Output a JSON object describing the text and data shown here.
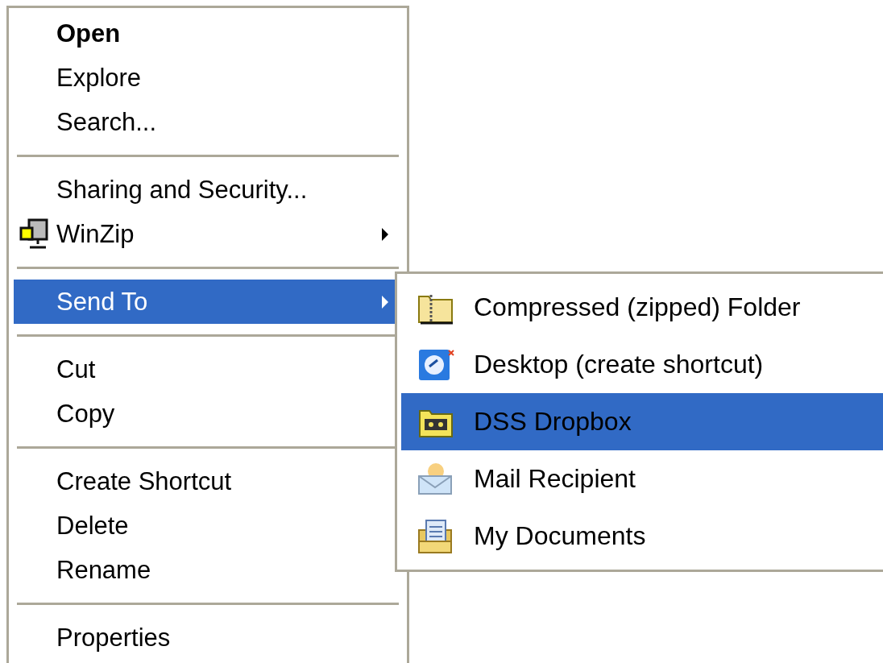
{
  "context_menu": {
    "items": [
      {
        "kind": "command",
        "label": "Open",
        "default": true,
        "selected": false,
        "has_submenu": false,
        "has_icon": false
      },
      {
        "kind": "command",
        "label": "Explore",
        "default": false,
        "selected": false,
        "has_submenu": false,
        "has_icon": false
      },
      {
        "kind": "command",
        "label": "Search...",
        "default": false,
        "selected": false,
        "has_submenu": false,
        "has_icon": false
      },
      {
        "kind": "separator"
      },
      {
        "kind": "command",
        "label": "Sharing and Security...",
        "default": false,
        "selected": false,
        "has_submenu": false,
        "has_icon": false
      },
      {
        "kind": "command",
        "label": "WinZip",
        "default": false,
        "selected": false,
        "has_submenu": true,
        "has_icon": true
      },
      {
        "kind": "separator"
      },
      {
        "kind": "command",
        "label": "Send To",
        "default": false,
        "selected": true,
        "has_submenu": true,
        "has_icon": false,
        "submenu": [
          {
            "label": "Compressed (zipped) Folder",
            "selected": false
          },
          {
            "label": "Desktop (create shortcut)",
            "selected": false
          },
          {
            "label": "DSS Dropbox",
            "selected": true
          },
          {
            "label": "Mail Recipient",
            "selected": false
          },
          {
            "label": "My Documents",
            "selected": false
          }
        ]
      },
      {
        "kind": "separator"
      },
      {
        "kind": "command",
        "label": "Cut",
        "default": false,
        "selected": false,
        "has_submenu": false,
        "has_icon": false
      },
      {
        "kind": "command",
        "label": "Copy",
        "default": false,
        "selected": false,
        "has_submenu": false,
        "has_icon": false
      },
      {
        "kind": "separator"
      },
      {
        "kind": "command",
        "label": "Create Shortcut",
        "default": false,
        "selected": false,
        "has_submenu": false,
        "has_icon": false
      },
      {
        "kind": "command",
        "label": "Delete",
        "default": false,
        "selected": false,
        "has_submenu": false,
        "has_icon": false
      },
      {
        "kind": "command",
        "label": "Rename",
        "default": false,
        "selected": false,
        "has_submenu": false,
        "has_icon": false
      },
      {
        "kind": "separator"
      },
      {
        "kind": "command",
        "label": "Properties",
        "default": false,
        "selected": false,
        "has_submenu": false,
        "has_icon": false
      }
    ]
  }
}
